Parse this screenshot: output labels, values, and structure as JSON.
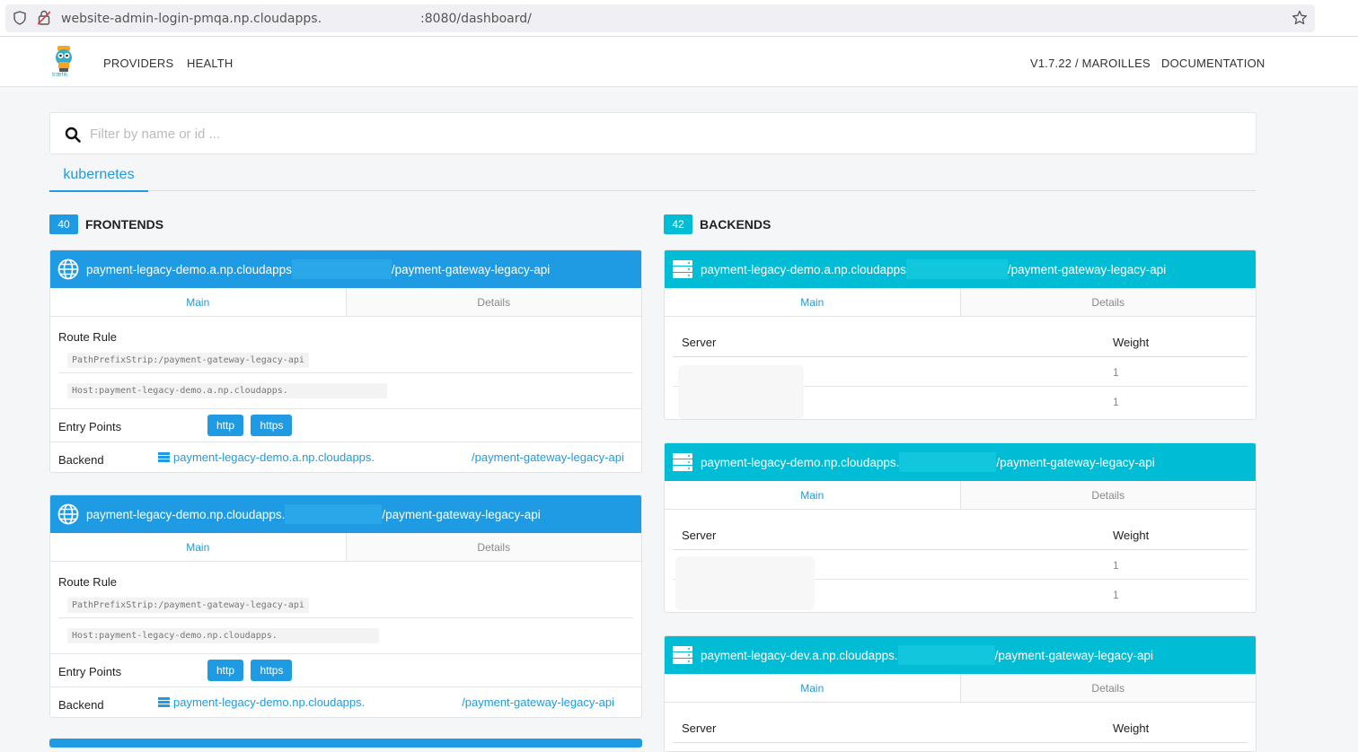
{
  "browser": {
    "url_prefix": "website-admin-login-pmqa.np.cloudapps.",
    "url_suffix": ":8080/dashboard/"
  },
  "nav": {
    "logo_text": "træfik",
    "links": [
      "PROVIDERS",
      "HEALTH"
    ],
    "version": "V1.7.22 / MAROILLES",
    "documentation": "DOCUMENTATION"
  },
  "search": {
    "placeholder": "Filter by name or id ..."
  },
  "provider_tab": "kubernetes",
  "frontends": {
    "count": "40",
    "title": "FRONTENDS",
    "cards": [
      {
        "name_prefix": "payment-legacy-demo.a.np.cloudapps",
        "name_suffix": "/payment-gateway-legacy-api",
        "tab_main": "Main",
        "tab_details": "Details",
        "route_rule_label": "Route Rule",
        "rule_path": "PathPrefixStrip:/payment-gateway-legacy-api",
        "rule_host": "Host:payment-legacy-demo.a.np.cloudapps.",
        "entry_points_label": "Entry Points",
        "entry_points": [
          "http",
          "https"
        ],
        "backend_label": "Backend",
        "backend_prefix": "payment-legacy-demo.a.np.cloudapps.",
        "backend_suffix": "/payment-gateway-legacy-api"
      },
      {
        "name_prefix": "payment-legacy-demo.np.cloudapps.",
        "name_suffix": "/payment-gateway-legacy-api",
        "tab_main": "Main",
        "tab_details": "Details",
        "route_rule_label": "Route Rule",
        "rule_path": "PathPrefixStrip:/payment-gateway-legacy-api",
        "rule_host": "Host:payment-legacy-demo.np.cloudapps.",
        "entry_points_label": "Entry Points",
        "entry_points": [
          "http",
          "https"
        ],
        "backend_label": "Backend",
        "backend_prefix": "payment-legacy-demo.np.cloudapps.",
        "backend_suffix": "/payment-gateway-legacy-api"
      }
    ]
  },
  "backends": {
    "count": "42",
    "title": "BACKENDS",
    "cards": [
      {
        "name_prefix": "payment-legacy-demo.a.np.cloudapps",
        "name_suffix": "/payment-gateway-legacy-api",
        "tab_main": "Main",
        "tab_details": "Details",
        "server_label": "Server",
        "weight_label": "Weight",
        "weights": [
          "1",
          "1"
        ]
      },
      {
        "name_prefix": "payment-legacy-demo.np.cloudapps.",
        "name_suffix": "/payment-gateway-legacy-api",
        "tab_main": "Main",
        "tab_details": "Details",
        "server_label": "Server",
        "weight_label": "Weight",
        "weights": [
          "1",
          "1"
        ]
      },
      {
        "name_prefix": "payment-legacy-dev.a.np.cloudapps.",
        "name_suffix": "/payment-gateway-legacy-api",
        "tab_main": "Main",
        "tab_details": "Details",
        "server_label": "Server",
        "weight_label": "Weight",
        "weights": []
      }
    ]
  },
  "colors": {
    "primary": "#1e9be3",
    "backend": "#00bcd4"
  }
}
